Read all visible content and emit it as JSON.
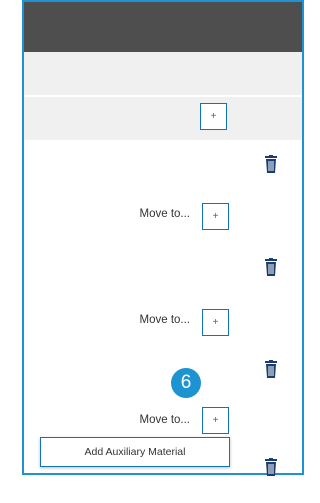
{
  "colors": {
    "accent": "#1d93d2",
    "button_border": "#1173b8",
    "header_bg": "#4e4e4e",
    "band_bg": "#f0f0f0",
    "trash": "#1b3d6e"
  },
  "row0": {
    "plus_label": "+"
  },
  "rows": [
    {
      "move_label": "Move to...",
      "plus_label": "+",
      "delete_icon": "trash-icon"
    },
    {
      "move_label": "Move to...",
      "plus_label": "+",
      "delete_icon": "trash-icon"
    },
    {
      "move_label": "Move to...",
      "plus_label": "+",
      "delete_icon": "trash-icon"
    }
  ],
  "badge": {
    "text": "6"
  },
  "menu": {
    "items": [
      {
        "label": "Add Auxiliary Material"
      }
    ]
  }
}
